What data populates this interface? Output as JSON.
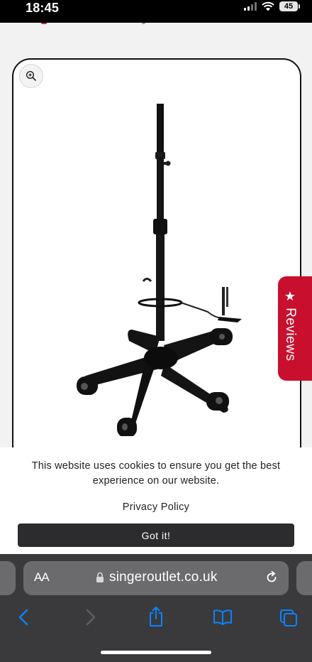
{
  "status_bar": {
    "time": "18:45",
    "battery": "45"
  },
  "product": {
    "zoom_icon": "zoom-in-icon",
    "image": "mobile floor stand with telescopic pole, five-leg caster base and foot pedal"
  },
  "reviews_tab": {
    "label": "Reviews",
    "icon": "star-icon",
    "color": "#c8102e"
  },
  "cookie_banner": {
    "message": "This website uses cookies to ensure you get the best experience on our website.",
    "privacy_link": "Privacy Policy",
    "accept_button": "Got it!"
  },
  "browser": {
    "text_size_label": "AA",
    "url": "singeroutlet.co.uk",
    "toolbar": [
      "back",
      "forward",
      "share",
      "bookmarks",
      "tabs"
    ]
  },
  "colors": {
    "accent": "#c8102e",
    "browser_chrome": "#3a3a3c",
    "ios_blue": "#0a84ff"
  }
}
